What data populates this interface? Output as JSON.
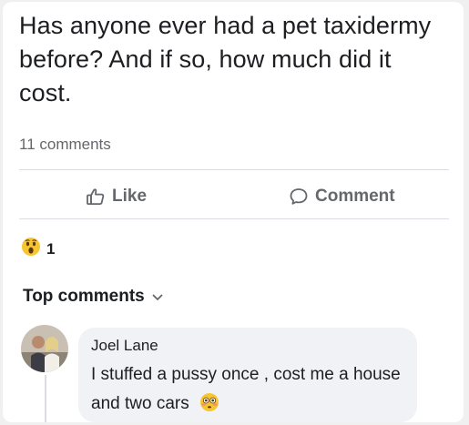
{
  "post": {
    "text": "Has anyone ever had a pet taxidermy before? And if so, how much did it cost.",
    "comments_count": "11 comments"
  },
  "actions": {
    "like_label": "Like",
    "comment_label": "Comment"
  },
  "reactions": {
    "icon": "wow-face-emoji",
    "count": "1"
  },
  "comments_section": {
    "sort_label": "Top comments"
  },
  "comment": {
    "author": "Joel Lane",
    "text": "I stuffed a pussy once , cost me a house and two cars",
    "emoji": "flushed-face-emoji"
  },
  "colors": {
    "text_primary": "#1c1e21",
    "text_secondary": "#65676b",
    "bubble_bg": "#f0f2f5",
    "divider": "#dadde1",
    "emoji_yellow": "#f7c531"
  }
}
